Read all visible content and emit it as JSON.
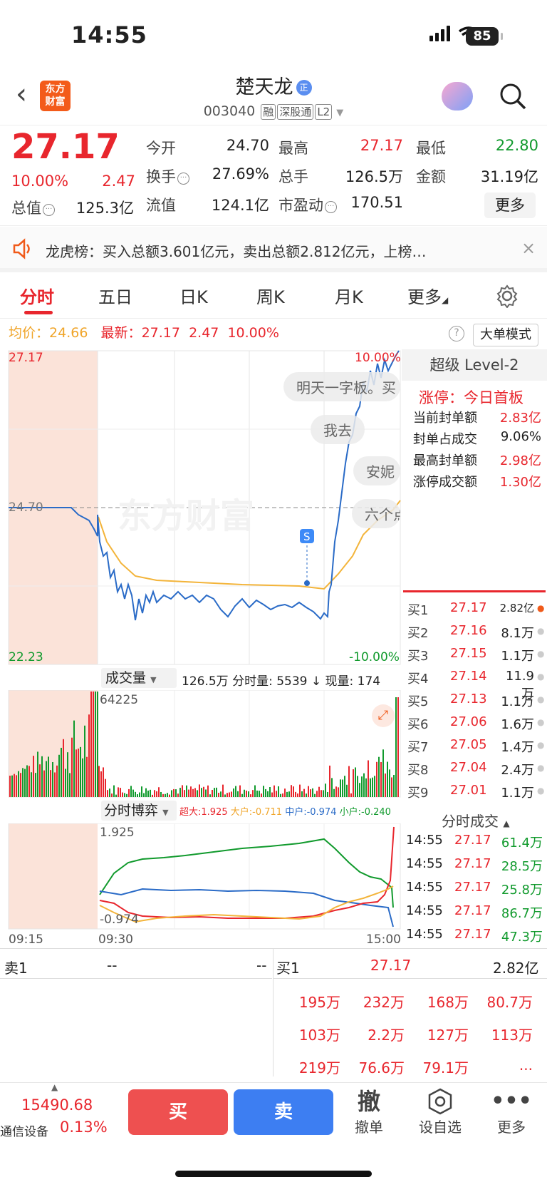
{
  "status": {
    "time": "14:55",
    "battery": "85"
  },
  "header": {
    "name": "楚天龙",
    "name_badge": "正",
    "logo": "东方\n财富",
    "code": "003040",
    "tags": [
      "融",
      "深股通",
      "L2"
    ]
  },
  "quote": {
    "price": "27.17",
    "pct": "10.00%",
    "chg": "2.47",
    "fields": [
      {
        "label": "今开",
        "value": "24.70",
        "color": "#222"
      },
      {
        "label": "最高",
        "value": "27.17",
        "color": "#e8262d"
      },
      {
        "label": "最低",
        "value": "22.80",
        "color": "#119a2d"
      },
      {
        "label": "换手",
        "value": "27.69%",
        "color": "#222"
      },
      {
        "label": "总手",
        "value": "126.5万",
        "color": "#222"
      },
      {
        "label": "金额",
        "value": "31.19亿",
        "color": "#222"
      },
      {
        "label": "总值",
        "value": "125.3亿",
        "color": "#222"
      },
      {
        "label": "流值",
        "value": "124.1亿",
        "color": "#222"
      },
      {
        "label": "市盈动",
        "value": "170.51",
        "color": "#222"
      }
    ],
    "more": "更多"
  },
  "notice": "龙虎榜：买入总额3.601亿元，卖出总额2.812亿元，上榜…",
  "tabs": [
    "分时",
    "五日",
    "日K",
    "周K",
    "月K",
    "更多"
  ],
  "chart_info": {
    "avg_label": "均价：",
    "avg": "24.66",
    "last_label": "最新：",
    "last": "27.17",
    "chg": "2.47",
    "pct": "10.00%",
    "mode": "大单模式"
  },
  "chart_labels": {
    "top": "27.17",
    "mid": "24.70",
    "bottom": "22.23",
    "top_pct": "10.00%",
    "bottom_pct": "-10.00%",
    "watermark": "东方财富",
    "s_mark": "S"
  },
  "bubbles": [
    "明天一字板。买",
    "我去",
    "安妮",
    "六个点"
  ],
  "volume_bar": {
    "label": "成交量",
    "total": "126.5万",
    "detail": "分时量: 5539 ↓ 现量: 174",
    "max": "64225"
  },
  "game_bar": {
    "label": "分时博弈",
    "big_label": "超大:1.925",
    "large_label": "大户:-0.711",
    "mid_label": "中户:-0.974",
    "small_label": "小户:-0.240",
    "top": "1.925",
    "bottom": "-0.974"
  },
  "x_axis": [
    "09:15",
    "09:30",
    "15:00"
  ],
  "level2": {
    "title": "超级 Level-2",
    "limit_label": "涨停：",
    "limit_value": "今日首板",
    "rows": [
      {
        "label": "当前封单额",
        "value": "2.83亿",
        "color": "#e8262d"
      },
      {
        "label": "封单占成交",
        "value": "9.06%",
        "color": "#222"
      },
      {
        "label": "最高封单额",
        "value": "2.98亿",
        "color": "#e8262d"
      },
      {
        "label": "涨停成交额",
        "value": "1.30亿",
        "color": "#e8262d"
      }
    ]
  },
  "bids": [
    {
      "lv": "买1",
      "price": "27.17",
      "vol": "2.82亿"
    },
    {
      "lv": "买2",
      "price": "27.16",
      "vol": "8.1万"
    },
    {
      "lv": "买3",
      "price": "27.15",
      "vol": "1.1万"
    },
    {
      "lv": "买4",
      "price": "27.14",
      "vol": "11.9万"
    },
    {
      "lv": "买5",
      "price": "27.13",
      "vol": "1.1万"
    },
    {
      "lv": "买6",
      "price": "27.06",
      "vol": "1.6万"
    },
    {
      "lv": "买7",
      "price": "27.05",
      "vol": "1.4万"
    },
    {
      "lv": "买8",
      "price": "27.04",
      "vol": "2.4万"
    },
    {
      "lv": "买9",
      "price": "27.01",
      "vol": "1.1万"
    }
  ],
  "trades_title": "分时成交",
  "trades": [
    {
      "t": "14:55",
      "p": "27.17",
      "v": "61.4万"
    },
    {
      "t": "14:55",
      "p": "27.17",
      "v": "28.5万"
    },
    {
      "t": "14:55",
      "p": "27.17",
      "v": "25.8万"
    },
    {
      "t": "14:55",
      "p": "27.17",
      "v": "86.7万"
    },
    {
      "t": "14:55",
      "p": "27.17",
      "v": "47.3万"
    }
  ],
  "queue": {
    "sell_label": "卖1",
    "sell_price": "--",
    "sell_vol": "--",
    "buy_label": "买1",
    "buy_price": "27.17",
    "buy_vol": "2.82亿",
    "vols": [
      "195万",
      "232万",
      "168万",
      "80.7万",
      "103万",
      "2.2万",
      "127万",
      "113万",
      "219万",
      "76.6万",
      "79.1万",
      "..."
    ]
  },
  "bottom": {
    "index_value": "15490.68",
    "index_name": "通信设备",
    "index_pct": "0.13%",
    "buy": "买",
    "sell": "卖",
    "cancel_glyph": "撤",
    "cancel": "撤单",
    "watch": "设自选",
    "more": "更多"
  }
}
